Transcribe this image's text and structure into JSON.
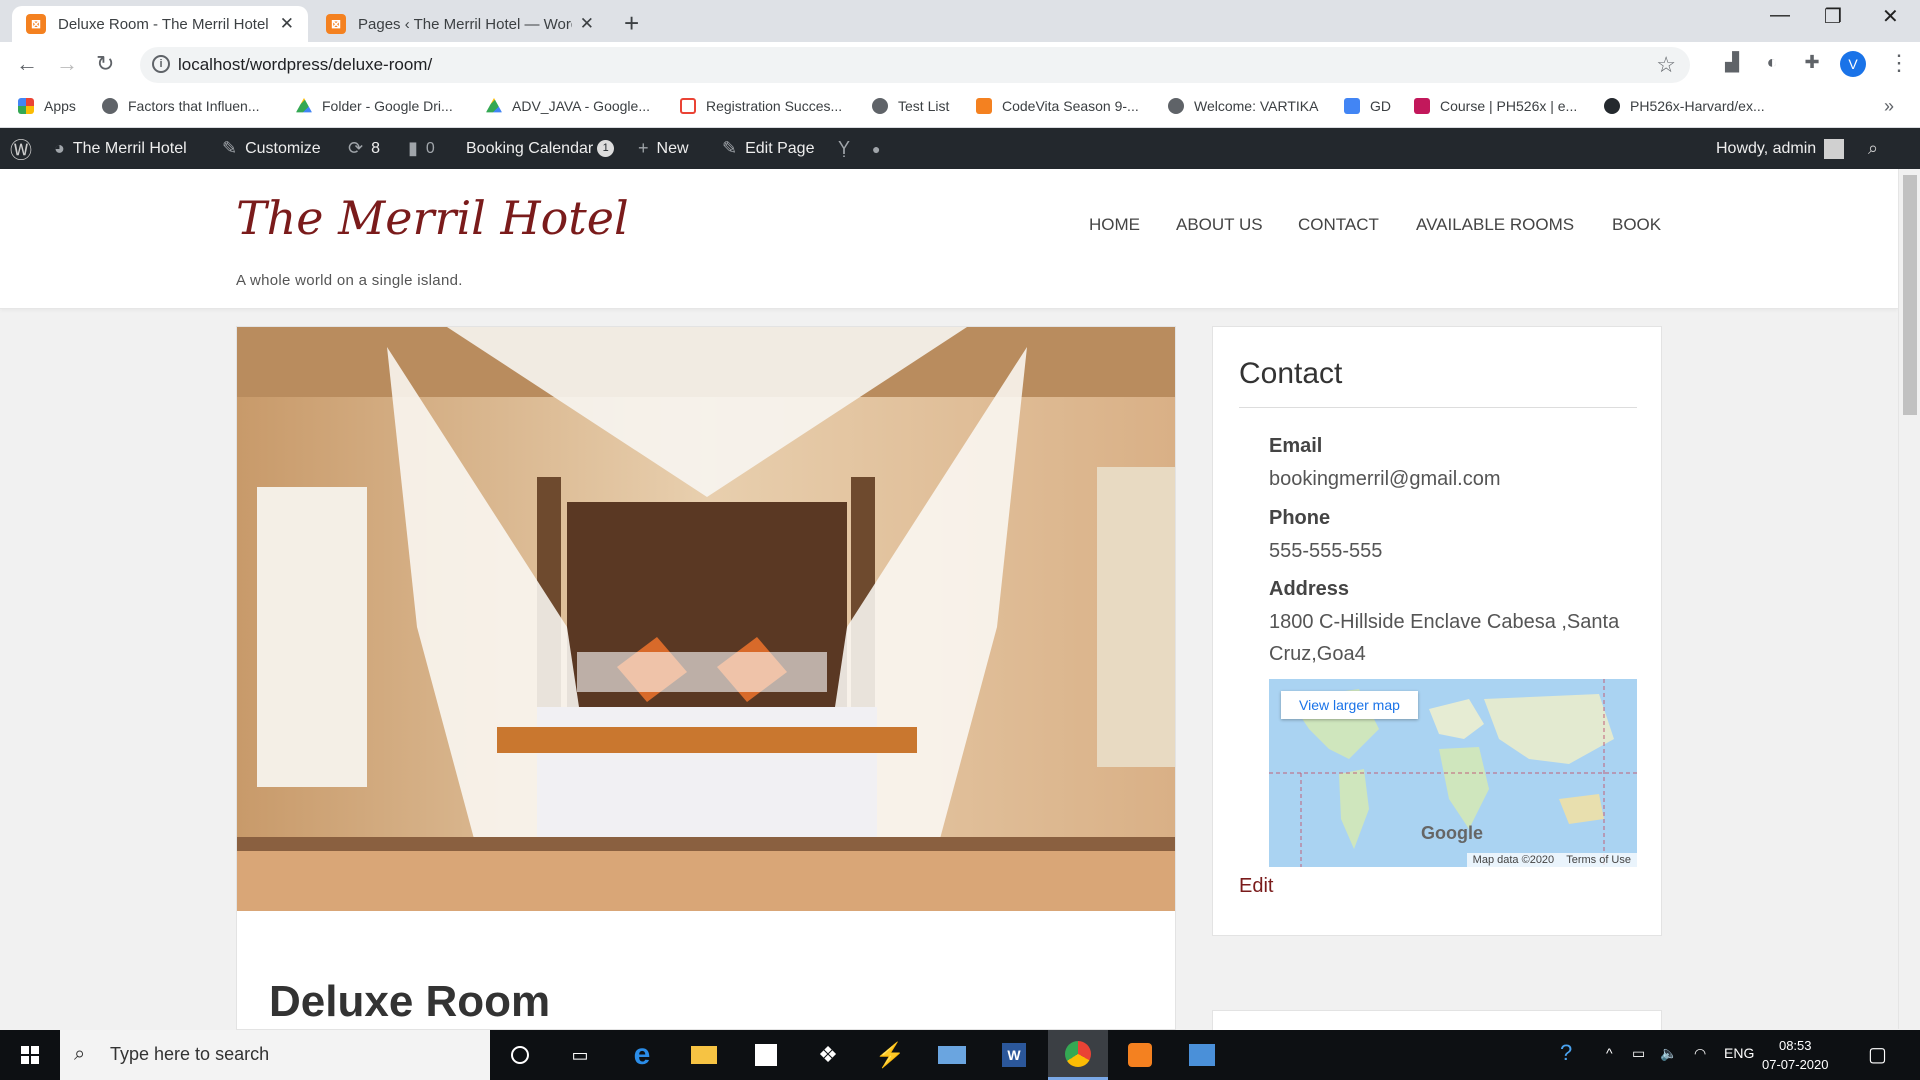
{
  "browser": {
    "tabs": [
      {
        "title": "Deluxe Room - The Merril Hotel",
        "active": true
      },
      {
        "title": "Pages ‹ The Merril Hotel — Word",
        "active": false
      }
    ],
    "url": "localhost/wordpress/deluxe-room/",
    "profile_initial": "V",
    "bookmarks": [
      {
        "label": "Apps",
        "icon_color": "#ea4335"
      },
      {
        "label": "Factors that Influen...",
        "icon_color": "#5f6368"
      },
      {
        "label": "Folder - Google Dri...",
        "icon_color": "#fbbc04"
      },
      {
        "label": "ADV_JAVA - Google...",
        "icon_color": "#34a853"
      },
      {
        "label": "Registration Succes...",
        "icon_color": "#ea4335"
      },
      {
        "label": "Test List",
        "icon_color": "#5f6368"
      },
      {
        "label": "CodeVita Season 9-...",
        "icon_color": "#f48120"
      },
      {
        "label": "Welcome: VARTIKA",
        "icon_color": "#5f6368"
      },
      {
        "label": "GD",
        "icon_color": "#4285f4"
      },
      {
        "label": "Course | PH526x | e...",
        "icon_color": "#c2185b"
      },
      {
        "label": "PH526x-Harvard/ex...",
        "icon_color": "#24292e"
      }
    ]
  },
  "adminbar": {
    "site_name": "The Merril Hotel",
    "customize": "Customize",
    "updates": "8",
    "comments": "0",
    "booking_calendar": "Booking Calendar",
    "booking_badge": "1",
    "new": "New",
    "edit_page": "Edit Page",
    "howdy": "Howdy, admin"
  },
  "site": {
    "title": "The Merril Hotel",
    "tagline": "A whole world on a single island.",
    "nav": [
      "HOME",
      "ABOUT US",
      "CONTACT",
      "AVAILABLE ROOMS",
      "BOOK"
    ],
    "accent_color": "#7a1b1b"
  },
  "page": {
    "entry_title": "Deluxe Room"
  },
  "contact_widget": {
    "title": "Contact",
    "email_label": "Email",
    "email": "bookingmerril@gmail.com",
    "phone_label": "Phone",
    "phone": "555-555-555",
    "address_label": "Address",
    "address": "1800 C-Hillside Enclave Cabesa ,Santa Cruz,Goa4",
    "map_link": "View larger map",
    "map_brand": "Google",
    "map_data": "Map data ©2020",
    "map_terms": "Terms of Use",
    "edit": "Edit"
  },
  "taskbar": {
    "search_placeholder": "Type here to search",
    "language": "ENG",
    "time": "08:53",
    "date": "07-07-2020"
  }
}
